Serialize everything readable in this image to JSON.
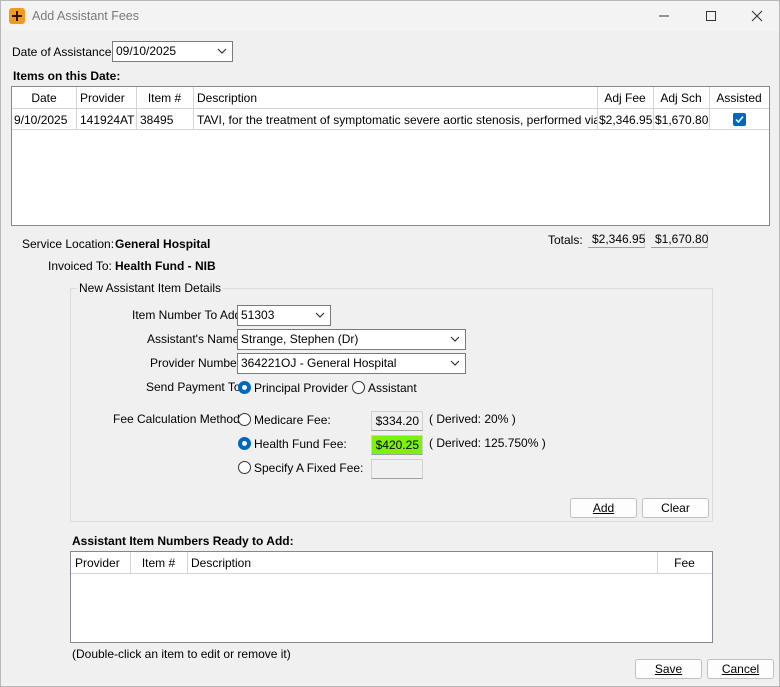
{
  "window": {
    "title": "Add Assistant Fees"
  },
  "date_of_assistance": {
    "label": "Date of Assistance",
    "value": "09/10/2025"
  },
  "items_section": {
    "label": "Items on this Date:",
    "columns": [
      "Date",
      "Provider",
      "Item #",
      "Description",
      "Adj Fee",
      "Adj Sch",
      "Assisted"
    ],
    "rows": [
      {
        "date": "9/10/2025",
        "provider": "141924AT",
        "item": "38495",
        "description": "TAVI, for the treatment of symptomatic severe aortic stenosis, performed via tra...",
        "adj_fee": "$2,346.95",
        "adj_sch": "$1,670.80",
        "assisted": true
      }
    ]
  },
  "totals": {
    "label": "Totals:",
    "adj_fee": "$2,346.95",
    "adj_sch": "$1,670.80"
  },
  "service_location": {
    "label": "Service Location:",
    "value": "General Hospital"
  },
  "invoiced_to": {
    "label": "Invoiced To:",
    "value": "Health Fund - NIB"
  },
  "new_item": {
    "group_title": "New Assistant Item Details",
    "item_number_label": "Item Number To Add",
    "item_number_value": "51303",
    "assistant_name_label": "Assistant's Name",
    "assistant_name_value": "Strange, Stephen (Dr)",
    "provider_number_label": "Provider Number",
    "provider_number_value": "364221OJ - General Hospital",
    "send_payment_label": "Send Payment To",
    "send_payment_options": [
      "Principal Provider",
      "Assistant"
    ],
    "send_payment_selected": "Principal Provider",
    "fee_method_label": "Fee Calculation Method:",
    "fee_methods": [
      {
        "label": "Medicare Fee:",
        "value": "$334.20",
        "derived": "( Derived: 20% )",
        "selected": false
      },
      {
        "label": "Health Fund Fee:",
        "value": "$420.25",
        "derived": "( Derived: 125.750% )",
        "selected": true
      },
      {
        "label": "Specify A Fixed Fee:",
        "value": "",
        "derived": "",
        "selected": false
      }
    ],
    "highlight_color": "#7cf20a",
    "add_label": "Add",
    "clear_label": "Clear"
  },
  "ready_section": {
    "label": "Assistant Item Numbers Ready to Add:",
    "columns": [
      "Provider",
      "Item #",
      "Description",
      "Fee"
    ],
    "hint": "(Double-click an item to edit or remove it)"
  },
  "footer": {
    "save_label": "Save",
    "cancel_label": "Cancel"
  },
  "colors": {
    "accent": "#0067c0",
    "app_icon": "#f29a1f"
  },
  "icons": [
    "app-icon",
    "minimize-icon",
    "maximize-icon",
    "close-icon",
    "chevron-down-icon",
    "checkmark-icon"
  ]
}
